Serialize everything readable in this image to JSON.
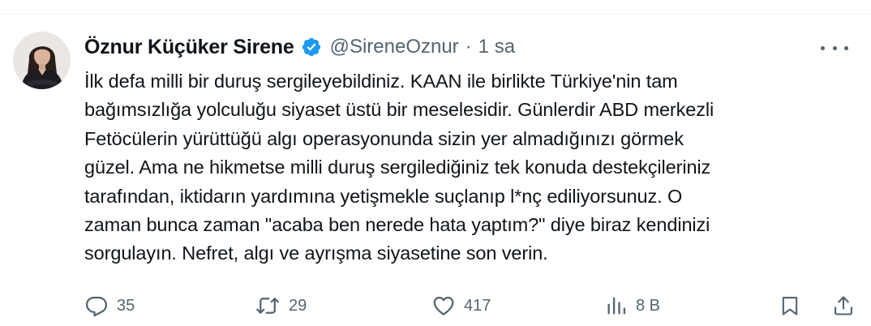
{
  "author": {
    "display_name": "Öznur Küçüker Sirene",
    "handle": "@SireneOznur",
    "separator": "·",
    "time": "1 sa",
    "verified": true,
    "verified_color": "#1d9bf0"
  },
  "tweet": {
    "text": "İlk defa milli bir duruş sergileyebildiniz. KAAN ile birlikte Türkiye'nin tam\nbağımsızlığa yolculuğu siyaset üstü bir meselesidir. Günlerdir ABD merkezli\nFetöcülerin yürüttüğü algı operasyonunda sizin yer almadığınızı görmek\ngüzel. Ama ne hikmetse milli duruş sergilediğiniz tek konuda destekçileriniz\ntarafından, iktidarın yardımına yetişmekle suçlanıp l*nç ediliyorsunuz. O\nzaman bunca zaman \"acaba ben nerede hata yaptım?\" diye biraz kendinizi\nsorgulayın. Nefret, algı ve ayrışma siyasetine son verin."
  },
  "actions": {
    "replies": "35",
    "reposts": "29",
    "likes": "417",
    "views": "8 B"
  },
  "icons": {
    "reply": "reply-bubble-icon",
    "repost": "repost-arrows-icon",
    "like": "heart-icon",
    "views": "bar-chart-icon",
    "bookmark": "bookmark-icon",
    "share": "share-upload-icon",
    "more": "more-dots-icon"
  }
}
